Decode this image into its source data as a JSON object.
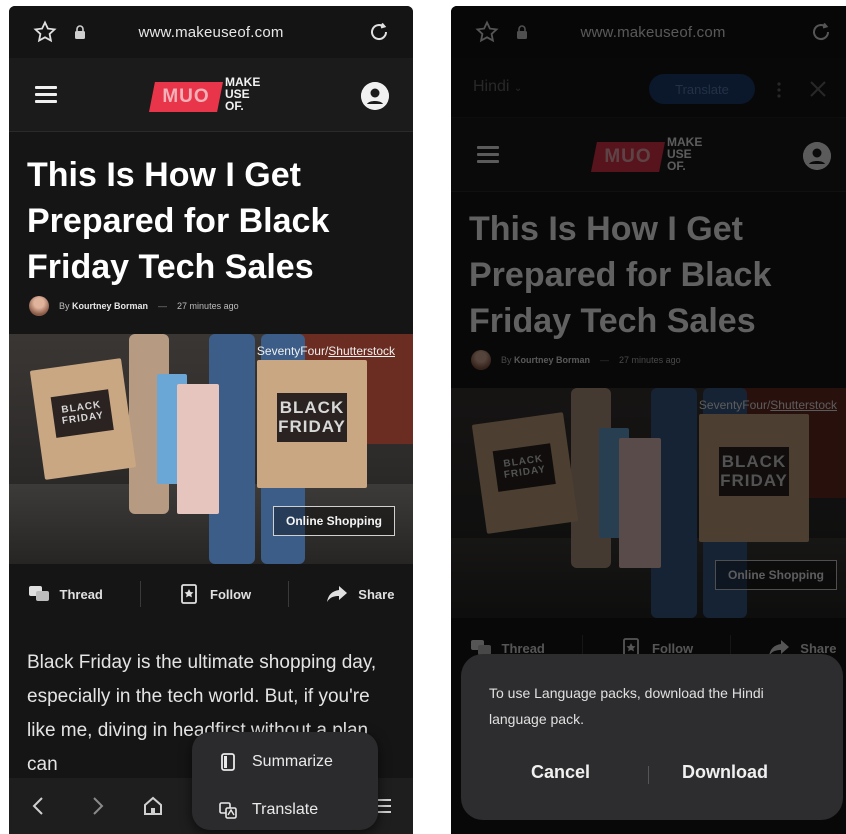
{
  "left": {
    "url": "www.makeuseof.com",
    "logo": {
      "mark": "MUO",
      "words": [
        "MAKE",
        "USE",
        "OF."
      ]
    },
    "article": {
      "headline": "This Is How I Get Prepared for Black Friday Tech Sales",
      "byline_prefix": "By",
      "author": "Kourtney Borman",
      "time": "27 minutes ago",
      "image_credit_prefix": "SeventyFour/",
      "image_credit_link": "Shutterstock",
      "image_tag": "Online Shopping",
      "bag_text_1": "BLACK",
      "bag_text_2": "FRIDAY",
      "actions": [
        "Thread",
        "Follow",
        "Share"
      ],
      "body": "Black Friday is the ultimate shopping day, especially in the tech world. But, if you're like me, diving in headfirst without a plan can"
    },
    "popup": {
      "summarize": "Summarize",
      "translate": "Translate"
    }
  },
  "right": {
    "url": "www.makeuseof.com",
    "translate_bar": {
      "language": "Hindi",
      "translate_button": "Translate"
    },
    "dialog": {
      "message": "To use Language packs, download the Hindi language pack.",
      "cancel": "Cancel",
      "download": "Download"
    }
  },
  "colors": {
    "brand": "#e8354a",
    "translate_button": "#1d3d72",
    "background": "#151515"
  }
}
